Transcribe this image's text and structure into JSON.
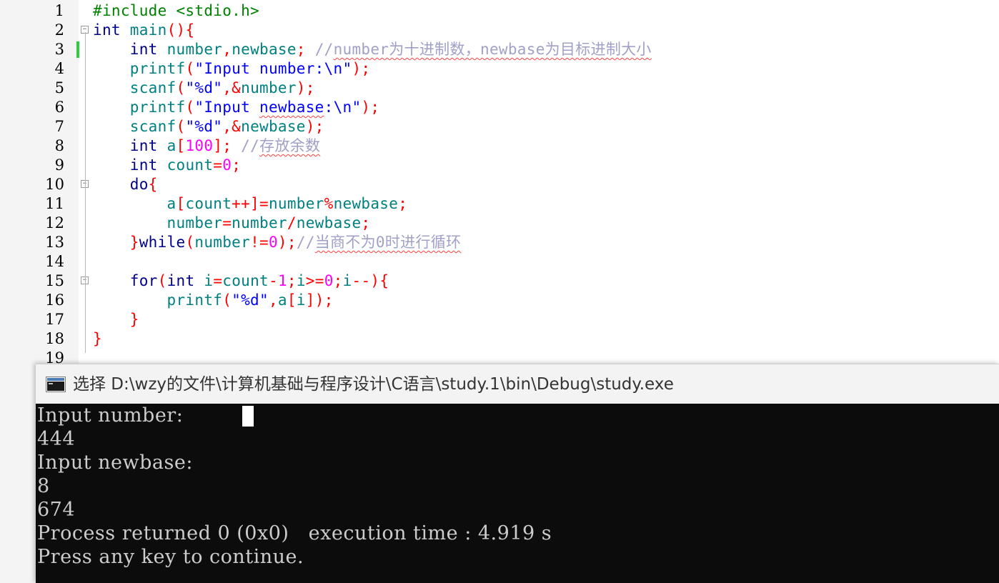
{
  "editor": {
    "line_numbers": [
      "1",
      "2",
      "3",
      "4",
      "5",
      "6",
      "7",
      "8",
      "9",
      "10",
      "11",
      "12",
      "13",
      "14",
      "15",
      "16",
      "17",
      "18",
      "19"
    ],
    "lines": [
      [
        {
          "t": "#include <stdio.h>",
          "c": "pp"
        }
      ],
      [
        {
          "t": "int",
          "c": "kw"
        },
        {
          "t": " main",
          "c": "fn"
        },
        {
          "t": "(){",
          "c": "op"
        }
      ],
      [
        {
          "t": "    "
        },
        {
          "t": "int",
          "c": "kw"
        },
        {
          "t": " number",
          "c": "id"
        },
        {
          "t": ",",
          "c": "op"
        },
        {
          "t": "newbase",
          "c": "id"
        },
        {
          "t": "; ",
          "c": "op"
        },
        {
          "t": "//",
          "c": "cm"
        },
        {
          "t": "number为十进制数，newbase为目标进制大小",
          "c": "cm sq"
        }
      ],
      [
        {
          "t": "    "
        },
        {
          "t": "printf",
          "c": "fn"
        },
        {
          "t": "(",
          "c": "op"
        },
        {
          "t": "\"Input number:\\n\"",
          "c": "str"
        },
        {
          "t": ");",
          "c": "op"
        }
      ],
      [
        {
          "t": "    "
        },
        {
          "t": "scanf",
          "c": "fn"
        },
        {
          "t": "(",
          "c": "op"
        },
        {
          "t": "\"%d\"",
          "c": "str"
        },
        {
          "t": ",&",
          "c": "op"
        },
        {
          "t": "number",
          "c": "id"
        },
        {
          "t": ");",
          "c": "op"
        }
      ],
      [
        {
          "t": "    "
        },
        {
          "t": "printf",
          "c": "fn"
        },
        {
          "t": "(",
          "c": "op"
        },
        {
          "t": "\"Input ",
          "c": "str"
        },
        {
          "t": "newbase",
          "c": "str sq"
        },
        {
          "t": ":\\n\"",
          "c": "str"
        },
        {
          "t": ");",
          "c": "op"
        }
      ],
      [
        {
          "t": "    "
        },
        {
          "t": "scanf",
          "c": "fn"
        },
        {
          "t": "(",
          "c": "op"
        },
        {
          "t": "\"%d\"",
          "c": "str"
        },
        {
          "t": ",&",
          "c": "op"
        },
        {
          "t": "newbase",
          "c": "id"
        },
        {
          "t": ");",
          "c": "op"
        }
      ],
      [
        {
          "t": "    "
        },
        {
          "t": "int",
          "c": "kw"
        },
        {
          "t": " a",
          "c": "id"
        },
        {
          "t": "[",
          "c": "op"
        },
        {
          "t": "100",
          "c": "num"
        },
        {
          "t": "]; ",
          "c": "op"
        },
        {
          "t": "//",
          "c": "cm"
        },
        {
          "t": "存放余数",
          "c": "cm sq"
        }
      ],
      [
        {
          "t": "    "
        },
        {
          "t": "int",
          "c": "kw"
        },
        {
          "t": " count",
          "c": "id"
        },
        {
          "t": "=",
          "c": "op"
        },
        {
          "t": "0",
          "c": "num"
        },
        {
          "t": ";",
          "c": "op"
        }
      ],
      [
        {
          "t": "    "
        },
        {
          "t": "do",
          "c": "kw"
        },
        {
          "t": "{",
          "c": "op"
        }
      ],
      [
        {
          "t": "        "
        },
        {
          "t": "a",
          "c": "id"
        },
        {
          "t": "[",
          "c": "op"
        },
        {
          "t": "count",
          "c": "id"
        },
        {
          "t": "++]=",
          "c": "op"
        },
        {
          "t": "number",
          "c": "id"
        },
        {
          "t": "%",
          "c": "op"
        },
        {
          "t": "newbase",
          "c": "id"
        },
        {
          "t": ";",
          "c": "op"
        }
      ],
      [
        {
          "t": "        "
        },
        {
          "t": "number",
          "c": "id"
        },
        {
          "t": "=",
          "c": "op"
        },
        {
          "t": "number",
          "c": "id"
        },
        {
          "t": "/",
          "c": "op"
        },
        {
          "t": "newbase",
          "c": "id"
        },
        {
          "t": ";",
          "c": "op"
        }
      ],
      [
        {
          "t": "    "
        },
        {
          "t": "}",
          "c": "op"
        },
        {
          "t": "while",
          "c": "kw"
        },
        {
          "t": "(",
          "c": "op"
        },
        {
          "t": "number",
          "c": "id"
        },
        {
          "t": "!=",
          "c": "op"
        },
        {
          "t": "0",
          "c": "num"
        },
        {
          "t": ");",
          "c": "op"
        },
        {
          "t": "//",
          "c": "cm"
        },
        {
          "t": "当商不为0时进行循环",
          "c": "cm sq"
        }
      ],
      [],
      [
        {
          "t": "    "
        },
        {
          "t": "for",
          "c": "kw"
        },
        {
          "t": "(",
          "c": "op"
        },
        {
          "t": "int",
          "c": "kw"
        },
        {
          "t": " i",
          "c": "id"
        },
        {
          "t": "=",
          "c": "op"
        },
        {
          "t": "count",
          "c": "id"
        },
        {
          "t": "-",
          "c": "op"
        },
        {
          "t": "1",
          "c": "num"
        },
        {
          "t": ";",
          "c": "op"
        },
        {
          "t": "i",
          "c": "id"
        },
        {
          "t": ">=",
          "c": "op"
        },
        {
          "t": "0",
          "c": "num"
        },
        {
          "t": ";",
          "c": "op"
        },
        {
          "t": "i",
          "c": "id"
        },
        {
          "t": "--){",
          "c": "op"
        }
      ],
      [
        {
          "t": "        "
        },
        {
          "t": "printf",
          "c": "fn"
        },
        {
          "t": "(",
          "c": "op"
        },
        {
          "t": "\"%d\"",
          "c": "str"
        },
        {
          "t": ",",
          "c": "op"
        },
        {
          "t": "a",
          "c": "id"
        },
        {
          "t": "[",
          "c": "op"
        },
        {
          "t": "i",
          "c": "id"
        },
        {
          "t": "]);",
          "c": "op"
        }
      ],
      [
        {
          "t": "    "
        },
        {
          "t": "}",
          "c": "op"
        }
      ],
      [
        {
          "t": "}",
          "c": "op"
        }
      ],
      []
    ]
  },
  "console": {
    "title": "选择 D:\\wzy的文件\\计算机基础与程序设计\\C语言\\study.1\\bin\\Debug\\study.exe",
    "lines": [
      "Input number:",
      "444",
      "Input newbase:",
      "8",
      "674",
      "Process returned 0 (0x0)   execution time : 4.919 s",
      "Press any key to continue."
    ]
  }
}
